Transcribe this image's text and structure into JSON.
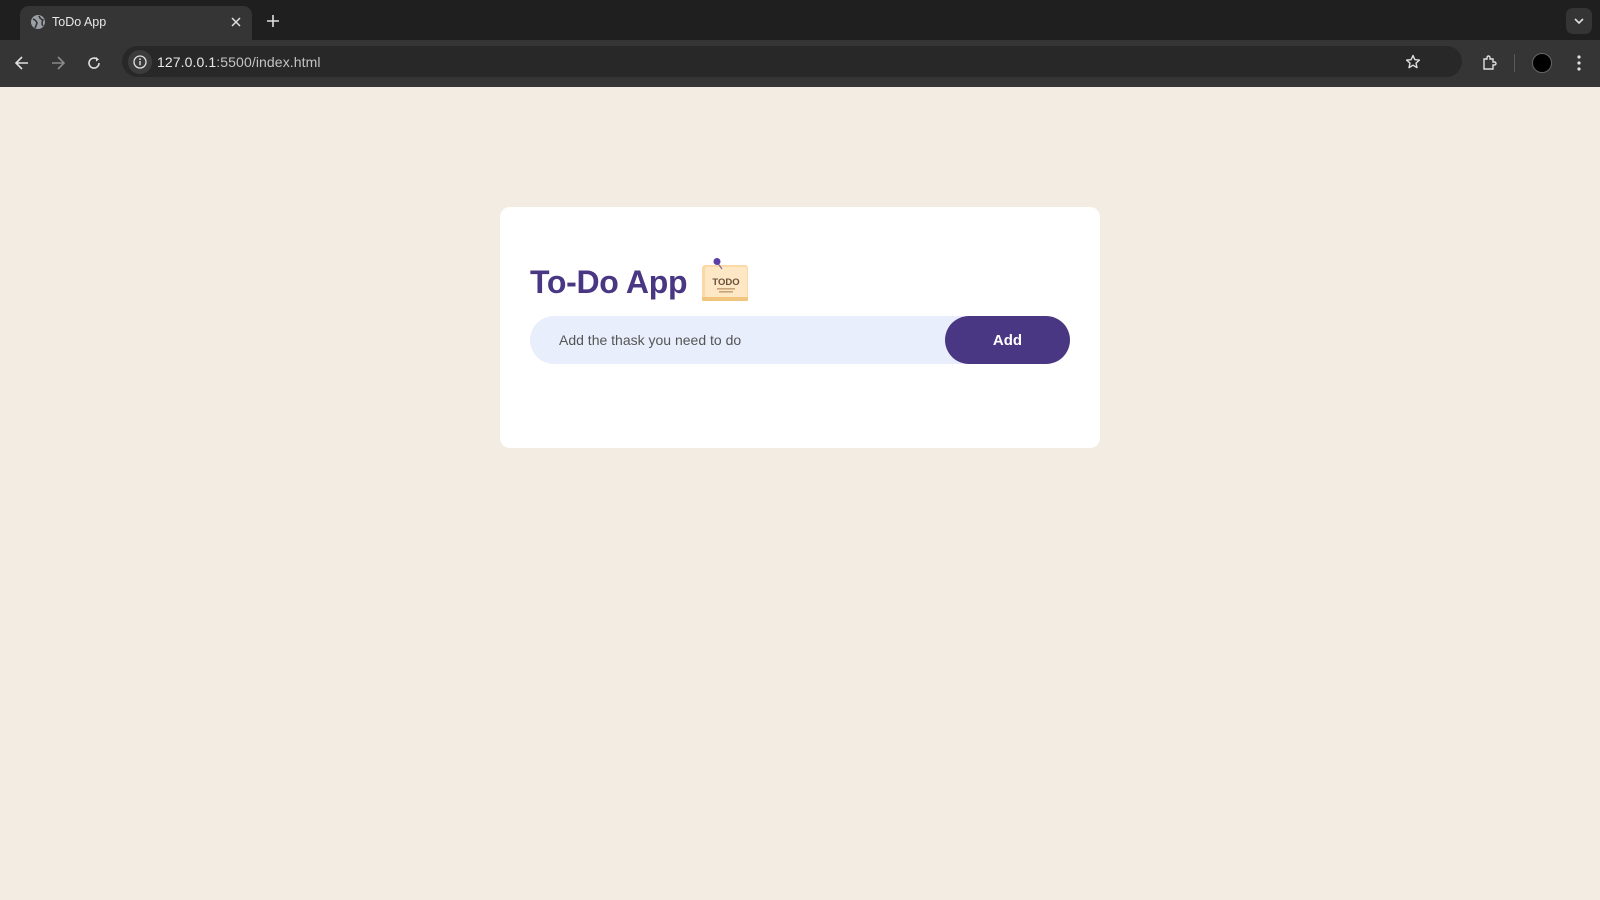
{
  "browser": {
    "tab_title": "ToDo App",
    "url_host": "127.0.0.1",
    "url_rest": ":5500/index.html"
  },
  "app": {
    "title": "To-Do App",
    "icon_text": "TODO",
    "input_placeholder": "Add the thask you need to do",
    "input_value": "",
    "add_label": "Add"
  },
  "colors": {
    "page_background": "#f3ece2",
    "card_background": "#ffffff",
    "accent": "#4a3783",
    "input_background": "#e8eefb"
  },
  "icons": [
    "globe-icon",
    "close-icon",
    "plus-icon",
    "back-arrow-icon",
    "forward-arrow-icon",
    "reload-icon",
    "info-icon",
    "star-icon",
    "extensions-icon",
    "kebab-menu-icon",
    "chevron-down-icon",
    "todo-note-icon"
  ]
}
